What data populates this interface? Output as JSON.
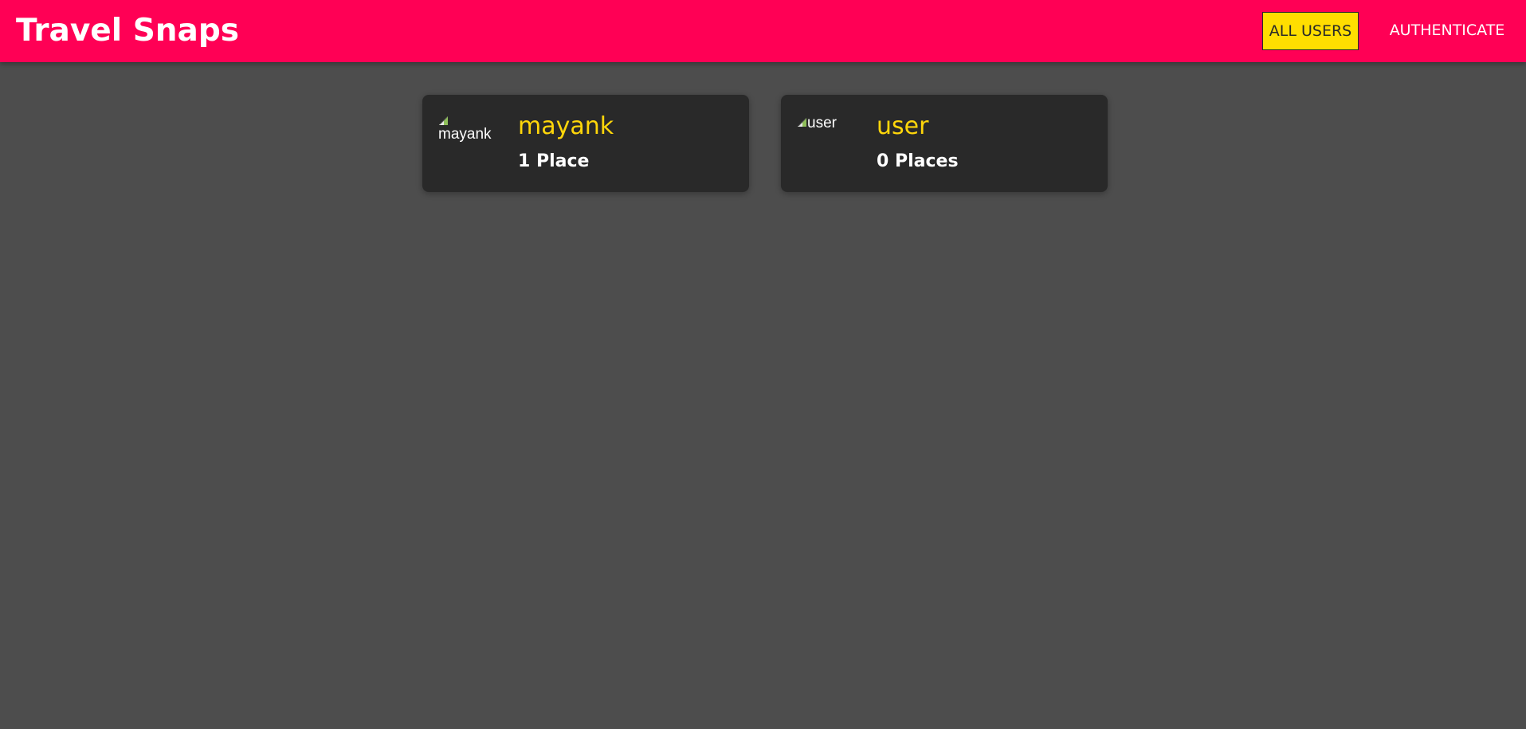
{
  "app": {
    "title": "Travel Snaps",
    "brand_color": "#ff0055",
    "accent_color": "#ffde00",
    "background_color": "#4d4d4d"
  },
  "nav": {
    "items": [
      {
        "label": "ALL USERS",
        "active": true
      },
      {
        "label": "AUTHENTICATE",
        "active": false
      }
    ]
  },
  "users": [
    {
      "name": "mayank",
      "places": "1 Place",
      "avatar_alt": "mayank",
      "avatar_icon": "broken-image-icon"
    },
    {
      "name": "user",
      "places": "0 Places",
      "avatar_alt": "user",
      "avatar_icon": "broken-image-icon"
    }
  ]
}
